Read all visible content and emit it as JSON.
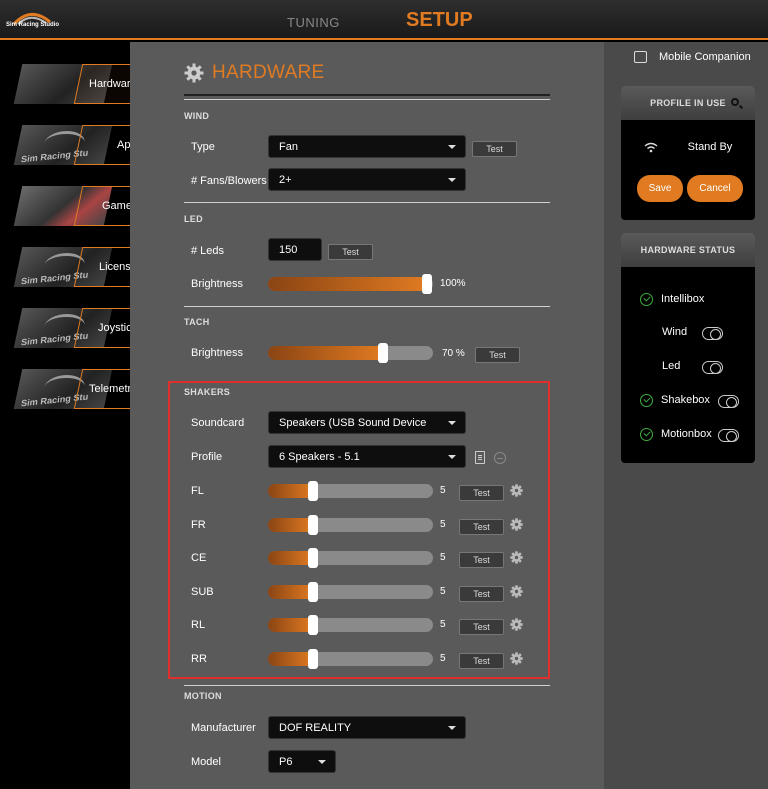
{
  "app": {
    "logo_text": "Sim Racing Studio",
    "nav_tuning": "TUNING",
    "nav_setup": "SETUP",
    "accent_color": "#e07b22"
  },
  "sidebar": {
    "thumb_brand": "Sim Racing Stu",
    "items": [
      {
        "label": "Hardware",
        "active": true
      },
      {
        "label": "App"
      },
      {
        "label": "Games"
      },
      {
        "label": "License"
      },
      {
        "label": "Joystick"
      },
      {
        "label": "Telemetry"
      }
    ]
  },
  "main": {
    "title": "HARDWARE",
    "wind": {
      "section": "WIND",
      "type_label": "Type",
      "type_value": "Fan",
      "fans_label": "# Fans/Blowers",
      "fans_value": "2+",
      "test": "Test"
    },
    "led": {
      "section": "LED",
      "leds_label": "# Leds",
      "leds_value": "150",
      "test": "Test",
      "brightness_label": "Brightness",
      "brightness_value": "100%",
      "brightness_fraction": 1.0
    },
    "tach": {
      "section": "TACH",
      "brightness_label": "Brightness",
      "brightness_value": "70 %",
      "brightness_fraction": 0.7,
      "test": "Test"
    },
    "shakers": {
      "section": "SHAKERS",
      "soundcard_label": "Soundcard",
      "soundcard_value": "Speakers (USB Sound Device",
      "profile_label": "Profile",
      "profile_value": "6 Speakers - 5.1",
      "test": "Test",
      "channels": [
        {
          "label": "FL",
          "value": "5",
          "fraction": 0.27
        },
        {
          "label": "FR",
          "value": "5",
          "fraction": 0.27
        },
        {
          "label": "CE",
          "value": "5",
          "fraction": 0.27
        },
        {
          "label": "SUB",
          "value": "5",
          "fraction": 0.27
        },
        {
          "label": "RL",
          "value": "5",
          "fraction": 0.27
        },
        {
          "label": "RR",
          "value": "5",
          "fraction": 0.27
        }
      ]
    },
    "motion": {
      "section": "MOTION",
      "manufacturer_label": "Manufacturer",
      "manufacturer_value": "DOF REALITY",
      "model_label": "Model",
      "model_value": "P6"
    }
  },
  "right": {
    "mobile_label": "Mobile Companion",
    "profile_card": {
      "title": "PROFILE IN USE",
      "status": "Stand By",
      "save": "Save",
      "cancel": "Cancel"
    },
    "status_card": {
      "title": "HARDWARE STATUS",
      "items": [
        {
          "label": "Intellibox",
          "kind": "check"
        },
        {
          "label": "Wind",
          "kind": "toggle"
        },
        {
          "label": "Led",
          "kind": "toggle"
        },
        {
          "label": "Shakebox",
          "kind": "check-toggle"
        },
        {
          "label": "Motionbox",
          "kind": "check-toggle"
        }
      ]
    }
  }
}
